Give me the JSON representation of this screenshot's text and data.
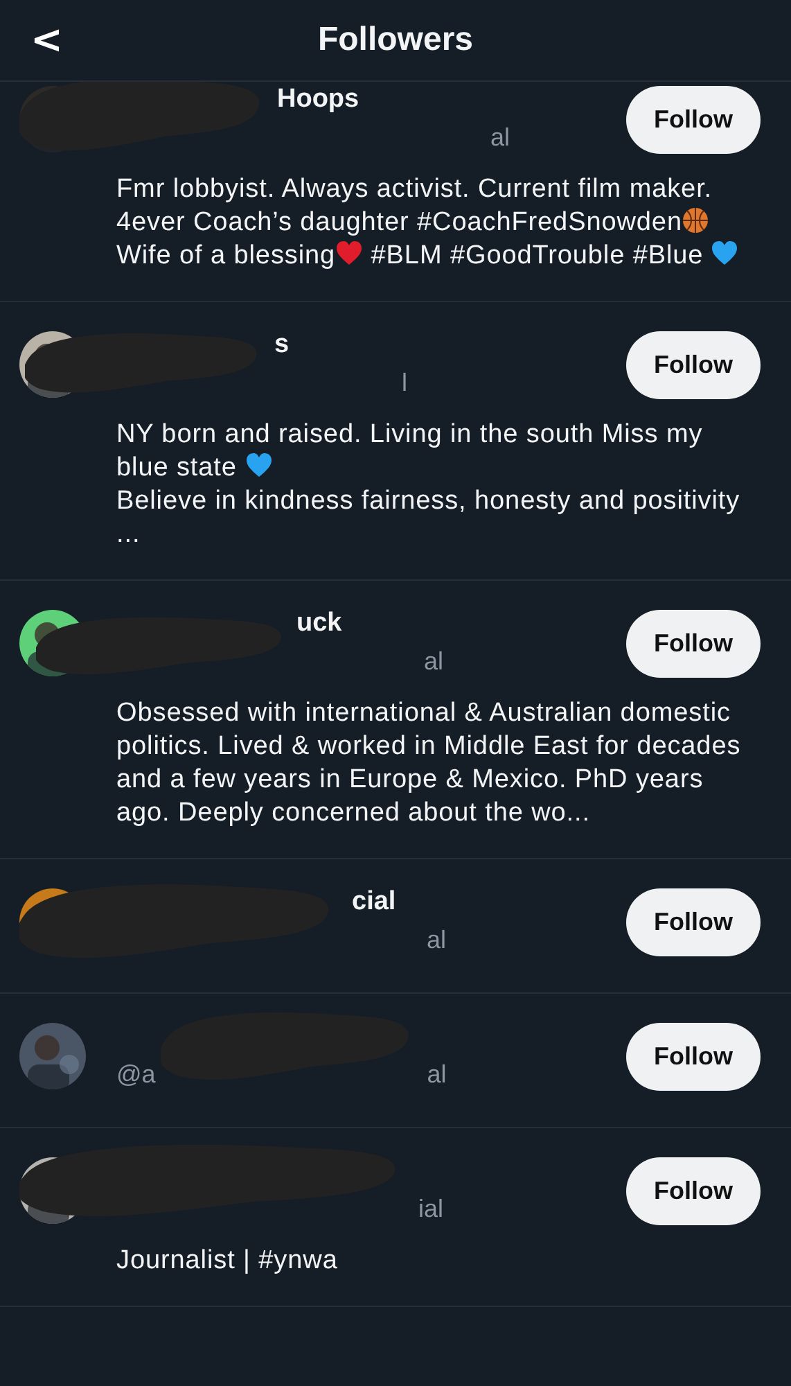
{
  "header": {
    "back": "<",
    "title": "Followers"
  },
  "followers": [
    {
      "name": "Hoops",
      "handle": "al",
      "button": "Follow",
      "bio": [
        {
          "kind": "text",
          "text": "Fmr lobbyist. Always activist. Current film maker. 4ever Coach’s daughter #CoachFredSnowden"
        },
        {
          "kind": "basketball"
        },
        {
          "kind": "text",
          "text": " Wife of a blessing"
        },
        {
          "kind": "red-heart"
        },
        {
          "kind": "text",
          "text": " #BLM #GoodTrouble #Blue "
        },
        {
          "kind": "blue-heart"
        }
      ]
    },
    {
      "name": "s",
      "handle": "l",
      "button": "Follow",
      "bio": [
        {
          "kind": "text",
          "text": "NY born and raised. Living in the south Miss my blue state "
        },
        {
          "kind": "blue-heart"
        },
        {
          "kind": "break"
        },
        {
          "kind": "text",
          "text": "Believe in kindness fairness, honesty and positivity ..."
        }
      ]
    },
    {
      "name": "uck",
      "handle": "al",
      "button": "Follow",
      "bio": [
        {
          "kind": "text",
          "text": "Obsessed with international & Australian domestic politics. Lived & worked  in Middle East for decades and a few years in Europe & Mexico. PhD years ago. Deeply concerned about the wo..."
        }
      ]
    },
    {
      "name": "cial",
      "handle": "al",
      "button": "Follow"
    },
    {
      "handle": "@a",
      "handle_end": "al",
      "button": "Follow"
    },
    {
      "handle": "ial",
      "button": "Follow",
      "bio": [
        {
          "kind": "text",
          "text": "Journalist | #ynwa"
        }
      ]
    }
  ]
}
